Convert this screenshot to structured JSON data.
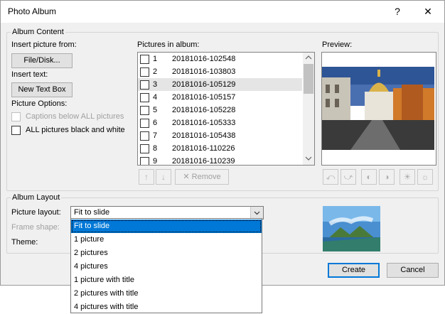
{
  "window": {
    "title": "Photo Album",
    "help_label": "?",
    "close_label": "✕"
  },
  "album_content": {
    "legend": "Album Content",
    "insert_picture_label": "Insert picture from:",
    "file_disk_button": "File/Disk...",
    "insert_text_label": "Insert text:",
    "new_text_box_button": "New Text Box",
    "picture_options_label": "Picture Options:",
    "captions_label": "Captions below ALL pictures",
    "black_white_label": "ALL pictures black and white",
    "pictures_in_album_label": "Pictures in album:",
    "preview_label": "Preview:",
    "remove_button": "Remove",
    "pictures": [
      {
        "num": "1",
        "name": "20181016-102548"
      },
      {
        "num": "2",
        "name": "20181016-103803"
      },
      {
        "num": "3",
        "name": "20181016-105129"
      },
      {
        "num": "4",
        "name": "20181016-105157"
      },
      {
        "num": "5",
        "name": "20181016-105228"
      },
      {
        "num": "6",
        "name": "20181016-105333"
      },
      {
        "num": "7",
        "name": "20181016-105438"
      },
      {
        "num": "8",
        "name": "20181016-110226"
      },
      {
        "num": "9",
        "name": "20181016-110239"
      }
    ]
  },
  "album_layout": {
    "legend": "Album Layout",
    "picture_layout_label": "Picture layout:",
    "picture_layout_value": "Fit to slide",
    "frame_shape_label": "Frame shape:",
    "theme_label": "Theme:",
    "options": [
      "Fit to slide",
      "1 picture",
      "2 pictures",
      "4 pictures",
      "1 picture with title",
      "2 pictures with title",
      "4 pictures with title"
    ]
  },
  "footer": {
    "create_button": "Create",
    "cancel_button": "Cancel"
  },
  "icons": {
    "scroll_up": "scroll-up-icon",
    "scroll_down": "scroll-down-icon",
    "dropdown": "chevron-down-icon",
    "move_up": "arrow-up-icon",
    "move_down": "arrow-down-icon",
    "remove": "remove-x-icon"
  },
  "colors": {
    "accent": "#0078d7",
    "dialog_bg": "#f0f0f0",
    "selected_row": "#e5e5e5"
  }
}
